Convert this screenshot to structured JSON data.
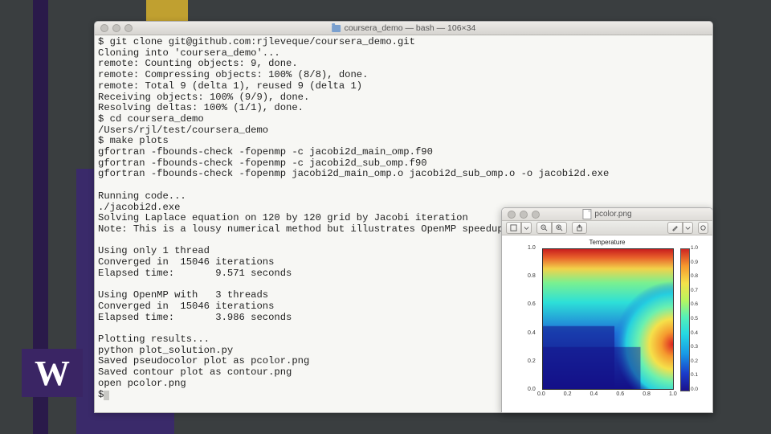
{
  "terminal": {
    "title": "coursera_demo — bash — 106×34",
    "lines": [
      "$ git clone git@github.com:rjleveque/coursera_demo.git",
      "Cloning into 'coursera_demo'...",
      "remote: Counting objects: 9, done.",
      "remote: Compressing objects: 100% (8/8), done.",
      "remote: Total 9 (delta 1), reused 9 (delta 1)",
      "Receiving objects: 100% (9/9), done.",
      "Resolving deltas: 100% (1/1), done.",
      "$ cd coursera_demo",
      "/Users/rjl/test/coursera_demo",
      "$ make plots",
      "gfortran -fbounds-check -fopenmp -c jacobi2d_main_omp.f90",
      "gfortran -fbounds-check -fopenmp -c jacobi2d_sub_omp.f90",
      "gfortran -fbounds-check -fopenmp jacobi2d_main_omp.o jacobi2d_sub_omp.o -o jacobi2d.exe",
      "",
      "Running code...",
      "./jacobi2d.exe",
      "Solving Laplace equation on 120 by 120 grid by Jacobi iteration",
      "Note: This is a lousy numerical method but illustrates OpenMP speedup",
      "",
      "Using only 1 thread",
      "Converged in  15046 iterations",
      "Elapsed time:       9.571 seconds",
      "",
      "Using OpenMP with   3 threads",
      "Converged in  15046 iterations",
      "Elapsed time:       3.986 seconds",
      "",
      "Plotting results...",
      "python plot_solution.py",
      "Saved pseudocolor plot as pcolor.png",
      "Saved contour plot as contour.png",
      "open pcolor.png",
      "$ "
    ]
  },
  "viewer": {
    "title": "pcolor.png",
    "chart_title": "Temperature",
    "x_ticks": [
      "0.0",
      "0.2",
      "0.4",
      "0.6",
      "0.8",
      "1.0"
    ],
    "y_ticks": [
      "0.0",
      "0.2",
      "0.4",
      "0.6",
      "0.8",
      "1.0"
    ],
    "cb_ticks": [
      "0.0",
      "0.1",
      "0.2",
      "0.3",
      "0.4",
      "0.5",
      "0.6",
      "0.7",
      "0.8",
      "0.9",
      "1.0"
    ]
  },
  "logo": {
    "letter": "W"
  },
  "chart_data": {
    "type": "heatmap",
    "title": "Temperature",
    "xlabel": "",
    "ylabel": "",
    "xlim": [
      0.0,
      1.0
    ],
    "ylim": [
      0.0,
      1.0
    ],
    "colorbar_range": [
      0.0,
      1.0
    ],
    "description": "Laplace equation solution on 120×120 grid. Top boundary T≈1.0 (red), bottom-left region T≈0.0 (dark blue). Hot spot on right boundary near y≈0.3. Smooth gradient elsewhere.",
    "boundary_samples": {
      "top": 1.0,
      "bottom": 0.0,
      "left": 0.0,
      "right_hotspot_y": 0.3,
      "right_hotspot_value": 1.0
    }
  }
}
